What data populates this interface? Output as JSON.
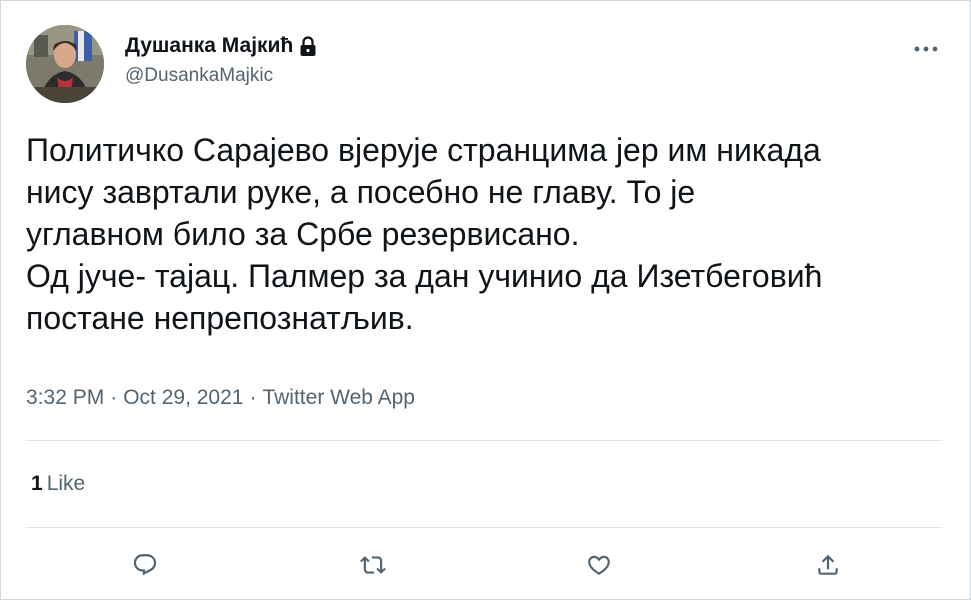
{
  "author": {
    "display_name": "Душанка Мајкић",
    "handle": "@DusankaMajkic",
    "avatar_icon": "profile-photo",
    "protected_icon": "lock-icon"
  },
  "tweet": {
    "lines": [
      "Политичко Сарајево вјерује странцима јер им никада",
      "нису завртали руке, а посебно не главу. То је",
      "углавном било за Србе резервисано.",
      "Од јуче- тајац. Палмер за дан учинио да Изетбеговић",
      "постане непрепознатљив."
    ],
    "time": "3:32 PM",
    "separator": "·",
    "date": "Oct 29, 2021",
    "source": "Twitter Web App"
  },
  "engagement": {
    "like_count": "1",
    "like_label": "Like"
  },
  "actions": {
    "reply_icon": "reply-icon",
    "retweet_icon": "retweet-icon",
    "like_icon": "heart-icon",
    "share_icon": "share-icon"
  },
  "colors": {
    "text": "#0f1419",
    "secondary": "#536471",
    "divider": "#dfe5e8"
  }
}
